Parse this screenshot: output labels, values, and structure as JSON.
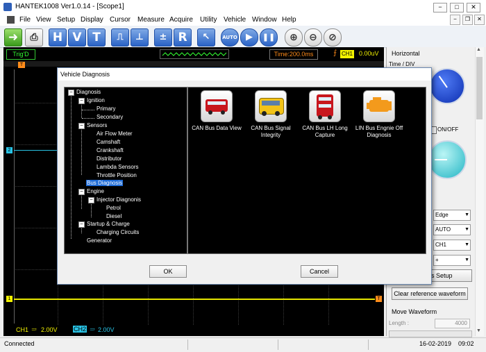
{
  "window": {
    "title": "HANTEK1008 Ver1.0.14 - [Scope1]",
    "min": "−",
    "max": "□",
    "close": "✕"
  },
  "menu": [
    "File",
    "View",
    "Setup",
    "Display",
    "Cursor",
    "Measure",
    "Acquire",
    "Utility",
    "Vehicle",
    "Window",
    "Help"
  ],
  "toolbar": {
    "h": "H",
    "v": "V",
    "t": "T",
    "auto": "AUTO",
    "r": "R"
  },
  "scope": {
    "trig_status": "Trig'D",
    "time": "Time:200.0ms",
    "trig_ch": "CH1",
    "trig_level": "0.00uV",
    "ch1_marker": "1",
    "ch2_marker": "2",
    "t_marker": "T",
    "ch1_scale": "CH1",
    "ch1_value": "2.00V",
    "ch2_scale": "CH2",
    "ch2_value": "2.00V",
    "colors": {
      "ch1": "#f2f200",
      "ch2": "#29c4e6",
      "trig": "#ff8c1a"
    }
  },
  "right_panel": {
    "horizontal": "Horizontal",
    "time_div": "Time / DIV",
    "on_off": "ON/OFF",
    "edge": "Edge",
    "mode": "AUTO",
    "source": "CH1",
    "slope": "+",
    "setup_partial": "s Setup",
    "clear_ref": "Clear reference waveform",
    "move_waveform": "Move Waveform",
    "length_label": "Length :",
    "length_value": "4000"
  },
  "dialog": {
    "title": "Vehicle Diagnosis",
    "ok": "OK",
    "cancel": "Cancel",
    "tree": {
      "diagnosis": "Diagnosis",
      "ignition": "Ignition",
      "primary": "Primary",
      "secondary": "Secondary",
      "sensors": "Sensors",
      "air_flow": "Air Flow Meter",
      "camshaft": "Camshaft",
      "crankshaft": "Crankshaft",
      "distributor": "Distributor",
      "lambda": "Lambda Sensors",
      "throttle": "Throttle Position",
      "bus": "Bus Diagnosis",
      "engine": "Engine",
      "injector": "Injector Diagnonis",
      "petrol": "Petrol",
      "diesel": "Diesel",
      "startup": "Startup & Charge",
      "charging": "Charging Circuits",
      "generator": "Generator",
      "expander_minus": "−"
    },
    "cards": [
      {
        "label": "CAN Bus Data View",
        "icon": "red-bus-icon"
      },
      {
        "label": "CAN Bus Signal Integrity",
        "icon": "yellow-bus-icon"
      },
      {
        "label": "CAN Bus LH Long Capture",
        "icon": "double-decker-bus-icon"
      },
      {
        "label": "LIN Bus Engnie Off Diagnosis",
        "icon": "check-engine-icon"
      }
    ]
  },
  "status": {
    "left": "Connected",
    "date": "16-02-2019",
    "time": "09:02"
  }
}
